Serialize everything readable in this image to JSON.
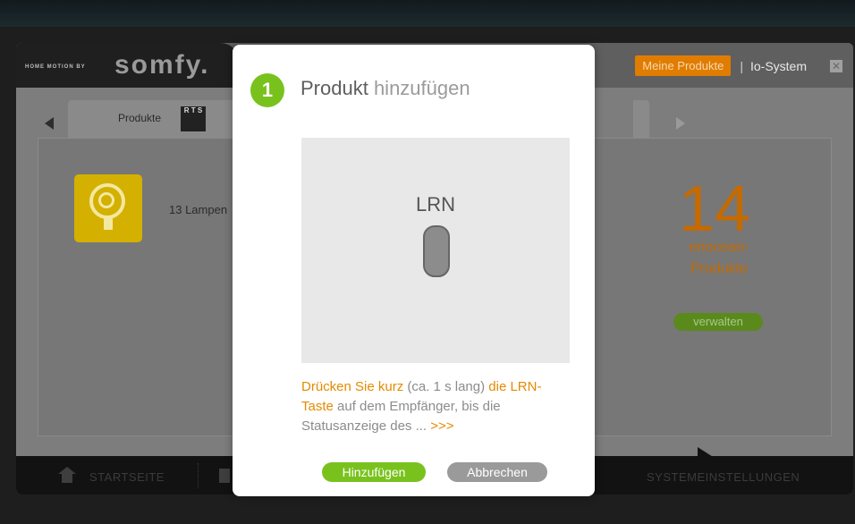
{
  "app": {
    "logo_tagline": "HOME MOTION BY",
    "logo_brand": "somfy.",
    "header": {
      "my_products": "Meine Produkte",
      "separator": "|",
      "io_system": "Io-System",
      "close_icon": "close-icon"
    },
    "tabs": [
      {
        "label": "Produkte",
        "badge": "R T S"
      }
    ],
    "content": {
      "lamp_label": "13 Lampen",
      "big_count": "14",
      "count_label_line1": "enocean-",
      "count_label_line2": "Produkte",
      "manage_button": "verwalten"
    },
    "bottom_nav": {
      "home_label": "STARTSEITE",
      "settings_label": "SYSTEMEINSTELLUNGEN"
    }
  },
  "modal": {
    "step_number": "1",
    "title_strong": "Produkt",
    "title_light": " hinzufügen",
    "device_label": "LRN",
    "instruction_parts": {
      "p1": "Drücken Sie kurz",
      "p2": " (ca. 1 s lang) ",
      "p3": "die LRN-Taste",
      "p4": " auf dem Empfänger, bis die Statusanzeige des ... ",
      "p5": ">>>"
    },
    "add_button": "Hinzufügen",
    "cancel_button": "Abbrechen"
  },
  "colors": {
    "accent_green": "#79c21d",
    "accent_orange": "#e58a00",
    "header_orange": "#e07d00"
  }
}
